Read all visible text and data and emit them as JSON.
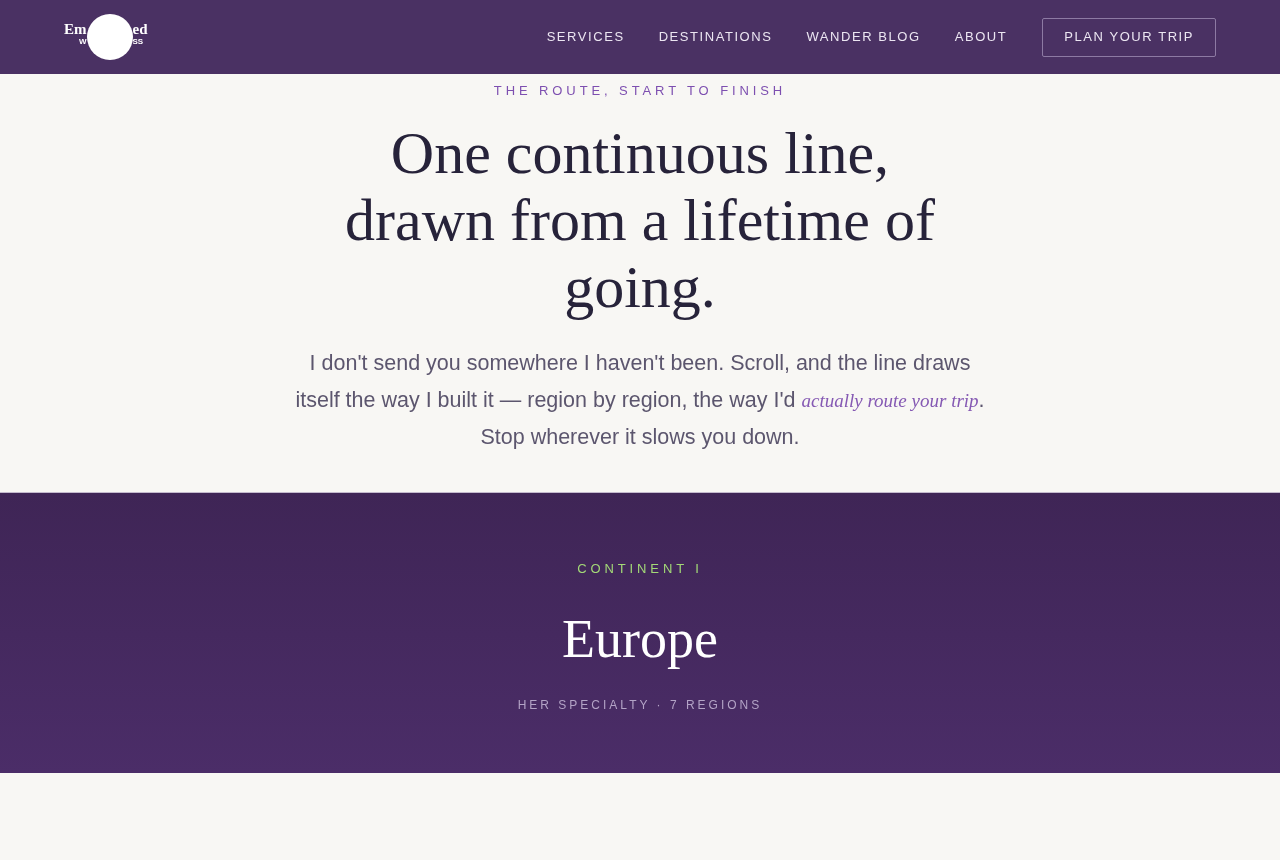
{
  "logo": {
    "top_left": "Em",
    "top_right": "ed",
    "bottom_left": "W",
    "bottom_right": "SS"
  },
  "nav": {
    "links": [
      {
        "label": "SERVICES"
      },
      {
        "label": "DESTINATIONS"
      },
      {
        "label": "WANDER BLOG"
      },
      {
        "label": "ABOUT"
      }
    ],
    "cta": "PLAN YOUR TRIP"
  },
  "intro": {
    "eyebrow": "THE ROUTE, START TO FINISH",
    "heading": "One continuous line, drawn from a lifetime of going.",
    "text_before": "I don't send you somewhere I haven't been. Scroll, and the line draws itself the way I built it — region by region, the way I'd ",
    "link": "actually route your trip",
    "text_after": ". Stop wherever it slows you down."
  },
  "continent": {
    "eyebrow": "CONTINENT I",
    "title": "Europe",
    "subtitle": "HER SPECIALTY · 7 REGIONS"
  }
}
